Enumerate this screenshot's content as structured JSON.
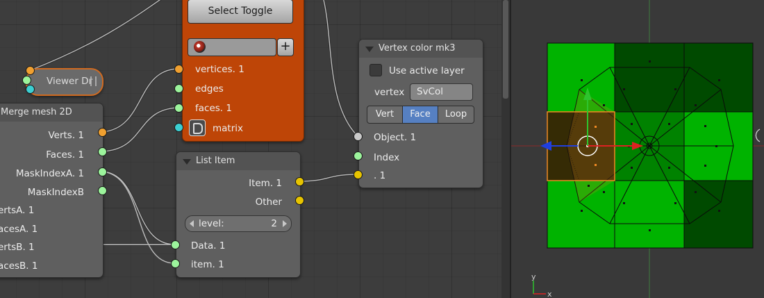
{
  "node_editor": {
    "viewer_node": {
      "label": "Viewer Dr"
    },
    "orange_node": {
      "select_toggle_label": "Select Toggle",
      "add_symbol": "+",
      "sockets": [
        "vertices. 1",
        "edges",
        "faces. 1",
        "matrix"
      ]
    },
    "merge_mesh_node": {
      "title": "Merge mesh 2D",
      "outputs": [
        "Verts. 1",
        "Faces. 1",
        "MaskIndexA. 1",
        "MaskIndexB"
      ],
      "inputs": [
        "ertsA. 1",
        "acesA. 1",
        "ertsB. 1",
        "acesB. 1"
      ]
    },
    "list_item_node": {
      "title": "List Item",
      "outputs": [
        "Item. 1",
        "Other"
      ],
      "level_label": "level:",
      "level_value": "2",
      "inputs": [
        "Data. 1",
        "item. 1"
      ]
    },
    "vertex_color_node": {
      "title": "Vertex color mk3",
      "use_active_layer_label": "Use active layer",
      "use_active_layer_checked": false,
      "vertex_label": "vertex",
      "vertex_value": "SvCol",
      "modes": [
        "Vert",
        "Face",
        "Loop"
      ],
      "active_mode": "Face",
      "inputs": [
        "Object. 1",
        "Index",
        ". 1"
      ]
    },
    "colors": {
      "node_body": "#5f5f5f",
      "orange_node": "#be4507",
      "socket_green": "#9cf49c",
      "socket_yellow": "#e7c400",
      "socket_orange": "#f0a030",
      "socket_cyan": "#3ccfd2",
      "socket_gray": "#c9c9c9",
      "selected_mode": "#5680c2",
      "selection_outline": "#f08a24"
    }
  },
  "viewport": {
    "axis_labels": {
      "y": "y",
      "x": "x"
    },
    "colors": {
      "bright_green": "#00b300",
      "dark_green": "#004a00",
      "mid_green": "#008200",
      "selected_face": "#352b05"
    }
  }
}
